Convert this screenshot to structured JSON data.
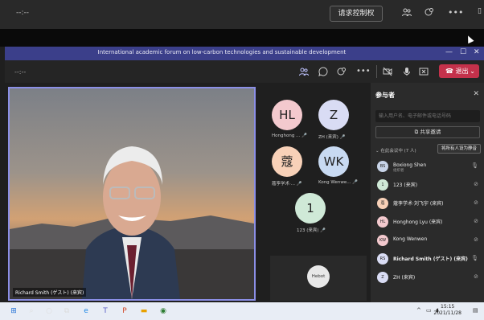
{
  "outer": {
    "time": "--:--",
    "request_control": "请求控制权",
    "people_icon": "people-icon",
    "more": "•••"
  },
  "window": {
    "title": "International academic forum on low-carbon technologies and sustainable development",
    "controls": {
      "minimize": "—",
      "maximize": "☐",
      "close": "✕"
    }
  },
  "toolbar": {
    "time": "--:--",
    "more": "•••",
    "leave_label": "退出",
    "leave_color": "#c4314b"
  },
  "main_video": {
    "label": "Richard Smith (ゲスト) (来宾)"
  },
  "tiles": [
    {
      "initials": "HL",
      "name": "Honghong ...",
      "color": "#f3c9ce"
    },
    {
      "initials": "Z",
      "name": "ZH (来宾)",
      "color": "#d9dcf4"
    },
    {
      "initials": "蔻",
      "name": "蔻孪学术·...",
      "color": "#f8d1b8"
    },
    {
      "initials": "WK",
      "name": "Kong Wenwe...",
      "color": "#c8daf2"
    },
    {
      "initials": "1",
      "name": "123 (来宾)",
      "color": "#cfe9d7"
    }
  ],
  "hebot": "Hebot",
  "panel": {
    "title": "参与者",
    "search_placeholder": "输入用户名、电子邮件或电话号码",
    "share_invite": "共享邀请",
    "in_meeting": "在此会议中 (7 人)",
    "mute_all": "将所有人设为静音",
    "participants": [
      {
        "initials": "BS",
        "name": "Boxiong Shen",
        "sub": "组织者",
        "color": "#c8d4e8",
        "mic": "on"
      },
      {
        "initials": "1",
        "name": "123 (来宾)",
        "sub": "",
        "color": "#cfe9d7",
        "mic": "off"
      },
      {
        "initials": "蔻",
        "name": "蔻孪学术·刘飞宇 (来宾)",
        "sub": "",
        "color": "#f8d1b8",
        "mic": "off"
      },
      {
        "initials": "HL",
        "name": "Honghong Lyu (来宾)",
        "sub": "",
        "color": "#f3c9ce",
        "mic": "off"
      },
      {
        "initials": "KW",
        "name": "Kong Wenwen",
        "sub": "",
        "color": "#f3c9ce",
        "mic": "off"
      },
      {
        "initials": "RS",
        "name": "Richard Smith (ゲスト) (来宾)",
        "sub": "",
        "color": "#d9dcf4",
        "mic": "on"
      },
      {
        "initials": "Z",
        "name": "ZH (来宾)",
        "sub": "",
        "color": "#d9dcf4",
        "mic": "off"
      }
    ]
  },
  "taskbar": {
    "time": "15:15",
    "date": "2021/11/28"
  }
}
